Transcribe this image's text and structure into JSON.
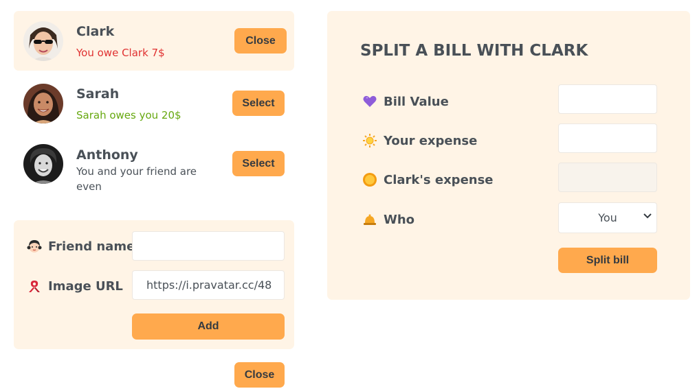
{
  "friends": [
    {
      "name": "Clark",
      "status": "You owe Clark 7$",
      "status_type": "red",
      "button": "Close",
      "selected": true
    },
    {
      "name": "Sarah",
      "status": "Sarah owes you 20$",
      "status_type": "green",
      "button": "Select",
      "selected": false
    },
    {
      "name": "Anthony",
      "status": "You and your friend are even",
      "status_type": "neutral",
      "button": "Select",
      "selected": false
    }
  ],
  "add_friend": {
    "name_label": "Friend name",
    "name_value": "",
    "url_label": "Image URL",
    "url_value": "https://i.pravatar.cc/48",
    "add_button": "Add",
    "name_icon": "girl-face-emoji",
    "url_icon": "red-ribbon-emoji"
  },
  "close_button": "Close",
  "split": {
    "title": "SPLIT A BILL WITH CLARK",
    "bill_label": "Bill Value",
    "bill_value": "",
    "your_label": "Your expense",
    "your_value": "",
    "friend_label": "Clark's expense",
    "friend_value": "",
    "who_label": "Who",
    "who_value": "You",
    "submit": "Split bill",
    "icons": [
      "purple-heart-emoji",
      "sun-emoji",
      "sun-with-face-emoji",
      "bell-emoji"
    ]
  },
  "colors": {
    "accent": "#ffa94d",
    "panel": "#fff4e6",
    "red": "#e03131",
    "green": "#66a80f",
    "text": "#495057"
  }
}
